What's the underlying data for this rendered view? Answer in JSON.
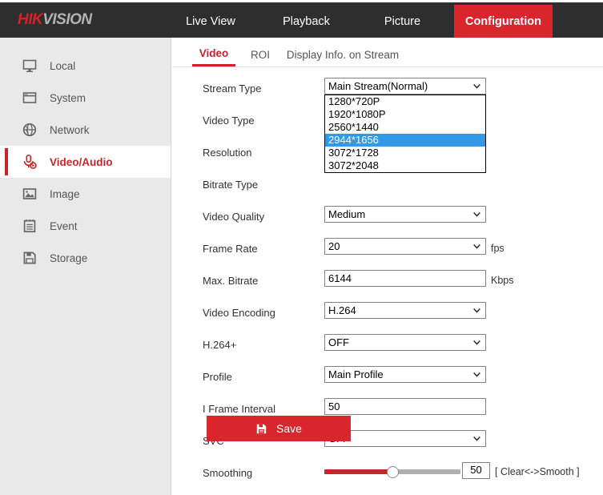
{
  "brand": {
    "part1": "HIK",
    "part2": "VISION"
  },
  "header": {
    "nav": [
      {
        "label": "Live View",
        "id": "live-view",
        "active": false
      },
      {
        "label": "Playback",
        "id": "playback",
        "active": false
      },
      {
        "label": "Picture",
        "id": "picture",
        "active": false
      },
      {
        "label": "Configuration",
        "id": "configuration",
        "active": true
      }
    ],
    "accent_color": "#d9262c",
    "bar_color": "#2e2e2e"
  },
  "sidebar": {
    "items": [
      {
        "label": "Local",
        "icon": "monitor-icon",
        "active": false
      },
      {
        "label": "System",
        "icon": "window-icon",
        "active": false
      },
      {
        "label": "Network",
        "icon": "globe-icon",
        "active": false
      },
      {
        "label": "Video/Audio",
        "icon": "microphone-icon",
        "active": true
      },
      {
        "label": "Image",
        "icon": "picture-icon",
        "active": false
      },
      {
        "label": "Event",
        "icon": "notepad-icon",
        "active": false
      },
      {
        "label": "Storage",
        "icon": "floppy-icon",
        "active": false
      }
    ]
  },
  "tabs": [
    {
      "label": "Video",
      "active": true
    },
    {
      "label": "ROI",
      "active": false
    },
    {
      "label": "Display Info. on Stream",
      "active": false
    }
  ],
  "form": {
    "stream_type": {
      "label": "Stream Type",
      "value": "Main Stream(Normal)",
      "control": "select"
    },
    "video_type": {
      "label": "Video Type",
      "value": "",
      "control": "select"
    },
    "resolution": {
      "label": "Resolution",
      "value": "",
      "control": "select"
    },
    "bitrate_type": {
      "label": "Bitrate Type",
      "value": "",
      "control": "select"
    },
    "video_quality": {
      "label": "Video Quality",
      "value": "Medium",
      "control": "select"
    },
    "frame_rate": {
      "label": "Frame Rate",
      "value": "20",
      "unit": "fps",
      "control": "select"
    },
    "max_bitrate": {
      "label": "Max. Bitrate",
      "value": "6144",
      "unit": "Kbps",
      "control": "text"
    },
    "video_encoding": {
      "label": "Video Encoding",
      "value": "H.264",
      "control": "select"
    },
    "h264_plus": {
      "label": "H.264+",
      "value": "OFF",
      "control": "select"
    },
    "profile": {
      "label": "Profile",
      "value": "Main Profile",
      "control": "select"
    },
    "i_frame_interval": {
      "label": "I Frame Interval",
      "value": "50",
      "control": "text"
    },
    "svc": {
      "label": "SVC",
      "value": "OFF",
      "control": "select"
    },
    "smoothing": {
      "label": "Smoothing",
      "value": "50",
      "hint": "[ Clear<->Smooth ]",
      "percent": 50
    }
  },
  "dropdown": {
    "open": true,
    "options": [
      {
        "label": "1280*720P",
        "selected": false
      },
      {
        "label": "1920*1080P",
        "selected": false
      },
      {
        "label": "2560*1440",
        "selected": false
      },
      {
        "label": "2944*1656",
        "selected": true
      },
      {
        "label": "3072*1728",
        "selected": false
      },
      {
        "label": "3072*2048",
        "selected": false
      }
    ],
    "highlight_color": "#3399e6"
  },
  "save": {
    "label": "Save",
    "icon": "floppy-disk-icon",
    "color": "#d9262c"
  }
}
